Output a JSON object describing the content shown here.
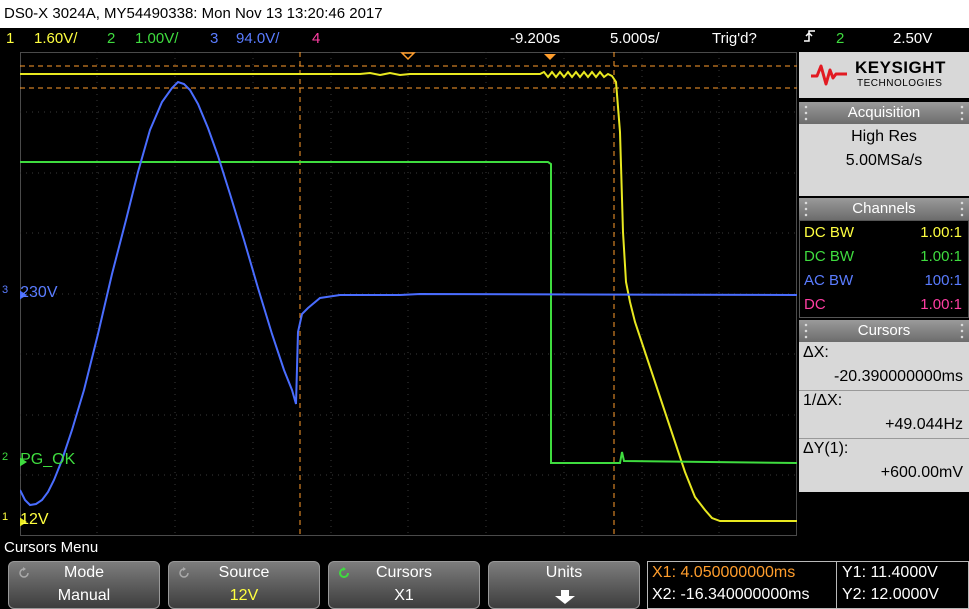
{
  "title_bar": {
    "text": "DS0-X 3024A, MY54490338: Mon Nov 13 13:20:46 2017"
  },
  "channel_bar": {
    "ch1": {
      "num": "1",
      "scale": "1.60V/"
    },
    "ch2": {
      "num": "2",
      "scale": "1.00V/"
    },
    "ch3": {
      "num": "3",
      "scale": "94.0V/"
    },
    "ch4": {
      "num": "4",
      "scale": ""
    },
    "delay": "-9.200ꜱ",
    "timebase": "5.000ꜱ/",
    "trigger_status": "Trig'd?",
    "trigger_source": "2",
    "trigger_level": "2.50V"
  },
  "waveform_labels": {
    "ch3": {
      "num": "3",
      "label": "230V"
    },
    "ch2": {
      "num": "2",
      "label": "PG_OK"
    },
    "ch1": {
      "num": "1",
      "label": "12V"
    }
  },
  "brand": {
    "name": "KEYSIGHT",
    "sub": "TECHNOLOGIES"
  },
  "acquisition": {
    "header": "Acquisition",
    "mode": "High Res",
    "rate": "5.00MSa/s"
  },
  "channels": {
    "header": "Channels",
    "rows": [
      {
        "coupling": "DC BW",
        "ratio": "1.00:1"
      },
      {
        "coupling": "DC BW",
        "ratio": "1.00:1"
      },
      {
        "coupling": "AC BW",
        "ratio": "100:1"
      },
      {
        "coupling": "DC",
        "ratio": "1.00:1"
      }
    ]
  },
  "cursors": {
    "header": "Cursors",
    "dx_label": "ΔX:",
    "dx_value": "-20.390000000ms",
    "inv_dx_label": "1/ΔX:",
    "inv_dx_value": "+49.044Hz",
    "dy_label": "ΔY(1):",
    "dy_value": "+600.00mV"
  },
  "menu": {
    "title": "Cursors Menu",
    "softkeys": [
      {
        "top": "Mode",
        "bottom": "Manual"
      },
      {
        "top": "Source",
        "bottom": "12V"
      },
      {
        "top": "Cursors",
        "bottom": "X1"
      },
      {
        "top": "Units",
        "bottom": ""
      }
    ]
  },
  "cursor_readout": {
    "x1": "X1: 4.050000000ms",
    "x2": "X2: -16.340000000ms",
    "y1": "Y1: 11.4000V",
    "y2": "Y2: 12.0000V"
  },
  "colors": {
    "ch1": "#ffff40",
    "ch2": "#3fdc3f",
    "ch3": "#5a7cff",
    "ch4": "#ff3ea3",
    "cursor": "#ff9d2c"
  },
  "icons": {
    "brand": "keysight-wave-icon",
    "rotate": "rotate-arrow-icon",
    "down": "down-arrow-icon"
  }
}
